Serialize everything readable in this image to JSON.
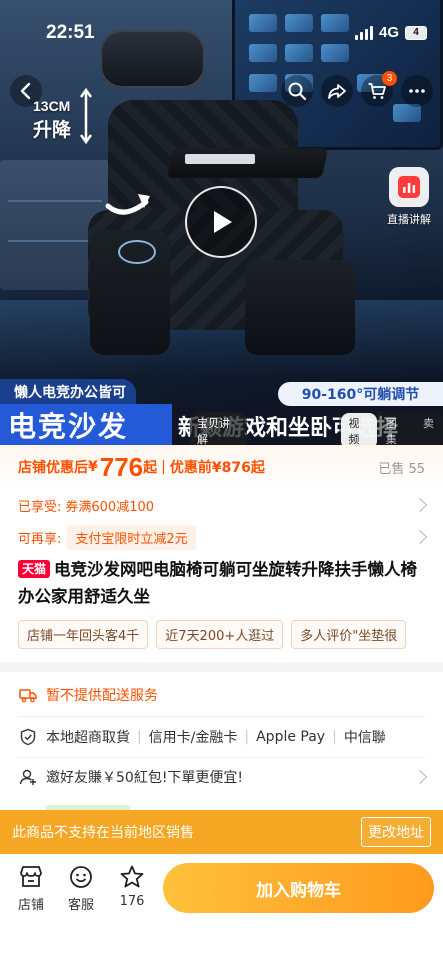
{
  "status_bar": {
    "time": "22:51",
    "network": "4G",
    "battery": "4"
  },
  "gallery": {
    "lift_label_size": "13CM",
    "lift_label_text": "升降",
    "live_label": "直播讲解",
    "cart_count": "3",
    "banner_left_top": "懒人电竞办公皆可",
    "banner_left_main": "电竞沙发",
    "banner_right_top": "90-160°可躺调节",
    "banner_right_main": "新颖游戏和坐卧可选择",
    "explain_tab": "宝贝讲解",
    "media_tabs": [
      "视频",
      "图集",
      "卖"
    ]
  },
  "price": {
    "label": "店铺优惠后",
    "currency": "¥",
    "amount": "776",
    "suffix": "起",
    "separator": "|",
    "before": "优惠前¥876起",
    "sold": "已售 55"
  },
  "promos": {
    "enjoyed_key": "已享受:",
    "enjoyed_value": "券满600减100",
    "available_key": "可再享:",
    "available_chip": "支付宝限时立减2元"
  },
  "product": {
    "tmall_tag": "天猫",
    "title": "电竞沙发网吧电脑椅可躺可坐旋转升降扶手懒人椅办公家用舒适久坐",
    "tags": [
      "店铺一年回头客4千",
      "近7天200+人逛过",
      "多人评价\"坐垫很"
    ]
  },
  "delivery": {
    "text": "暂不提供配送服务"
  },
  "services": [
    "本地超商取貨",
    "信用卡/金融卡",
    "Apple Pay",
    "中信聯"
  ],
  "invite": {
    "text": "邀好友賺￥50紅包!下單更便宜!"
  },
  "region_notice": {
    "text": "此商品不支持在当前地区销售",
    "button": "更改地址"
  },
  "bottom_bar": {
    "store_label": "店铺",
    "service_label": "客服",
    "fav_count": "176",
    "add_cart": "加入购物车"
  }
}
